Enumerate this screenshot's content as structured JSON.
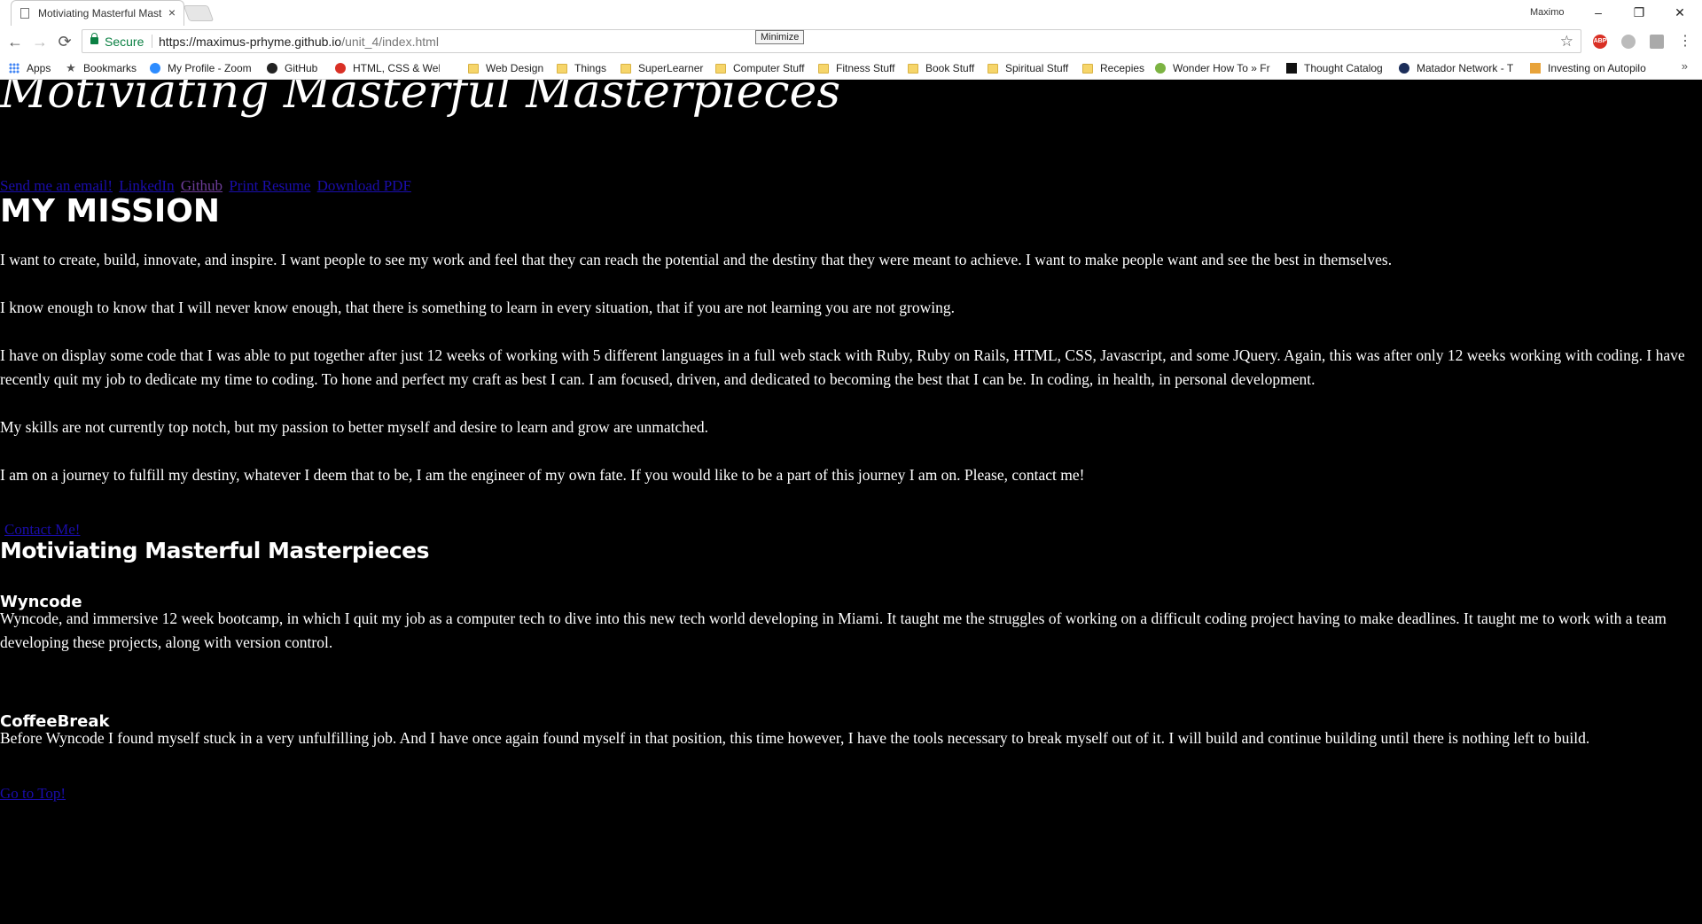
{
  "browser": {
    "tab_title": "Motiviating Masterful Masterpieces",
    "tab_close": "×",
    "profile_name": "Maximo",
    "window_controls": {
      "minimize": "–",
      "maximize": "❐",
      "close": "✕"
    },
    "tooltip": "Minimize",
    "nav": {
      "back": "←",
      "forward": "→",
      "reload": "⟳"
    },
    "secure_label": "Secure",
    "url_main": "https://maximus-prhyme.github.io",
    "url_path": "/unit_4/index.html",
    "bookmark_star": "☆",
    "more_bookmarks": "»",
    "bookmarks": [
      {
        "label": "Apps",
        "icon": "apps-icon"
      },
      {
        "label": "Bookmarks",
        "icon": "star-icon"
      },
      {
        "label": "My Profile - Zoom",
        "icon": "zoom-icon"
      },
      {
        "label": "GitHub",
        "icon": "github-icon"
      },
      {
        "label": "HTML, CSS & Web De",
        "icon": "codecademy-icon"
      },
      {
        "label": "Web Design",
        "icon": "folder-icon"
      },
      {
        "label": "Things",
        "icon": "folder-icon"
      },
      {
        "label": "SuperLearner",
        "icon": "folder-icon"
      },
      {
        "label": "Computer Stuff",
        "icon": "folder-icon"
      },
      {
        "label": "Fitness Stuff",
        "icon": "folder-icon"
      },
      {
        "label": "Book Stuff",
        "icon": "folder-icon"
      },
      {
        "label": "Spiritual Stuff",
        "icon": "folder-icon"
      },
      {
        "label": "Recepies",
        "icon": "folder-icon"
      },
      {
        "label": "Wonder How To » Fre",
        "icon": "wonderhowto-icon"
      },
      {
        "label": "Thought Catalog",
        "icon": "thought-catalog-icon"
      },
      {
        "label": "Matador Network - T",
        "icon": "matador-icon"
      },
      {
        "label": "Investing on Autopilo",
        "icon": "investing-icon"
      }
    ],
    "colors": {
      "secure_green": "#0b8043",
      "folder_yellow": "#f6d56a"
    }
  },
  "page": {
    "title": "Motiviating Masterful Masterpieces",
    "links": [
      "Send me an email!",
      "LinkedIn",
      "Github",
      "Print Resume",
      "Download PDF"
    ],
    "mission_heading": "MY MISSION",
    "paragraphs": [
      "I want to create, build, innovate, and inspire. I want people to see my work and feel that they can reach the potential and the destiny that they were meant to achieve. I want to make people want and see the best in themselves.",
      "I know enough to know that I will never know enough, that there is something to learn in every situation, that if you are not learning you are not growing.",
      "I have on display some code that I was able to put together after just 12 weeks of working with 5 different languages in a full web stack with Ruby, Ruby on Rails, HTML, CSS, Javascript, and some JQuery. Again, this was after only 12 weeks working with coding. I have recently quit my job to dedicate my time to coding. To hone and perfect my craft as best I can. I am focused, driven, and dedicated to becoming the best that I can be. In coding, in health, in personal development.",
      "My skills are not currently top notch, but my passion to better myself and desire to learn and grow are unmatched.",
      "I am on a journey to fulfill my destiny, whatever I deem that to be, I am the engineer of my own fate. If you would like to be a part of this journey I am on. Please, contact me!"
    ],
    "contact_link": "Contact Me!",
    "section_title": "Motiviating Masterful Masterpieces",
    "projects": [
      {
        "title": "Wyncode",
        "description": "Wyncode, and immersive 12 week bootcamp, in which I quit my job as a computer tech to dive into this new tech world developing in Miami. It taught me the struggles of working on a difficult coding project having to make deadlines. It taught me to work with a team developing these projects, along with version control."
      },
      {
        "title": "CoffeeBreak",
        "description": "Before Wyncode I found myself stuck in a very unfulfilling job. And I have once again found myself in that position, this time however, I have the tools necessary to break myself out of it. I will build and continue building until there is nothing left to build."
      }
    ],
    "top_link": "Go to Top!",
    "colors": {
      "background": "#000000",
      "text": "#ffffff",
      "link": "#1a0dab",
      "visited_link": "#6d3d9a"
    }
  }
}
